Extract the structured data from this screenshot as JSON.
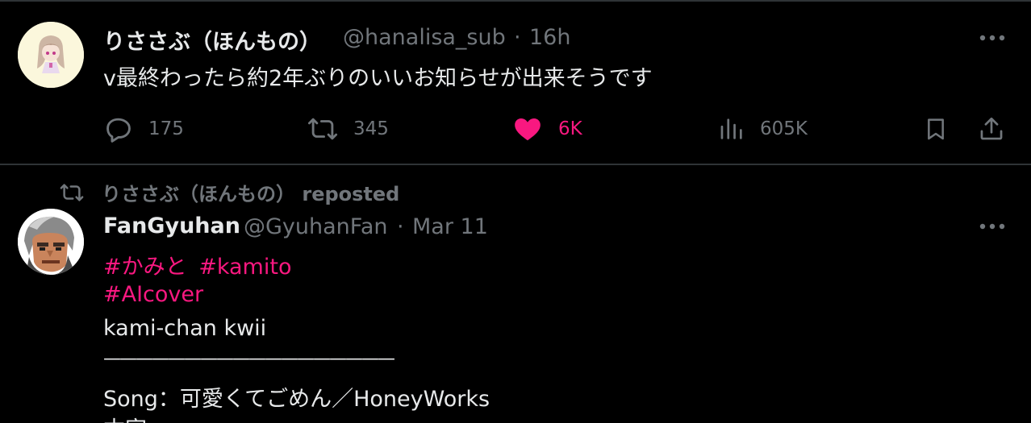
{
  "tweet1": {
    "display_name": "りささぶ（ほんもの）",
    "handle": "@hanalisa_sub",
    "separator": "·",
    "time": "16h",
    "text": "v最終わったら約2年ぶりのいいお知らせが出来そうです",
    "replies": "175",
    "reposts": "345",
    "likes": "6K",
    "views": "605K",
    "liked": true
  },
  "tweet2": {
    "repost_text": "りささぶ（ほんもの） reposted",
    "display_name": "FanGyuhan",
    "handle": "@GyuhanFan",
    "separator": "·",
    "date": "Mar 11",
    "hashtag_line1_a": "#かみと",
    "hashtag_line1_b": "#kamito",
    "hashtag_line2": "#AIcover",
    "line3": "kami-chan kwii",
    "rule": "——————————————————",
    "song_line": "Song：可愛くてごめん／HoneyWorks",
    "partial_line": "本家"
  },
  "colors": {
    "background": "#000000",
    "text": "#e7e9ea",
    "muted": "#71767b",
    "like_pink": "#f91880",
    "divider": "#2f3336"
  },
  "icons": [
    "reply-icon",
    "repost-icon",
    "heart-icon",
    "views-icon",
    "bookmark-icon",
    "share-icon",
    "more-icon"
  ]
}
